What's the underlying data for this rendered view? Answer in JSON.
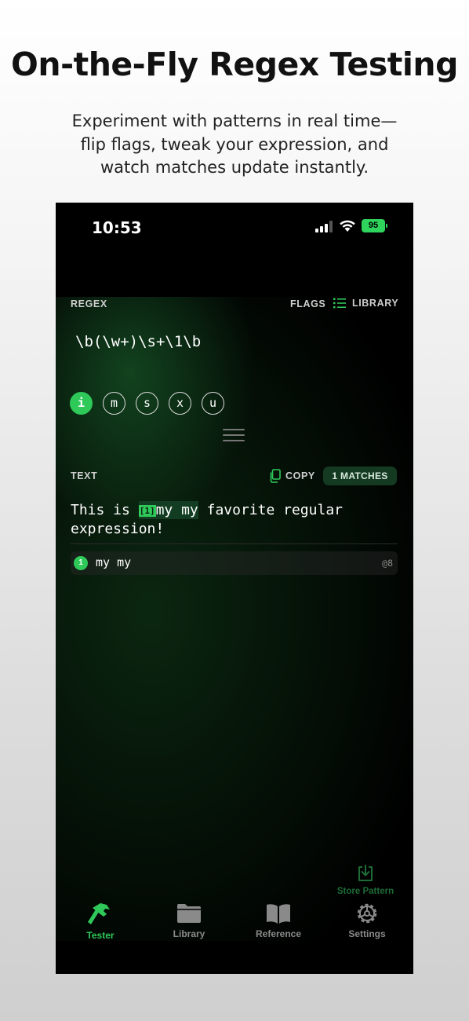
{
  "promo": {
    "headline": "On-the-Fly Regex Testing",
    "subhead": "Experiment with patterns in real time— flip flags, tweak your expression, and watch matches update instantly."
  },
  "status_bar": {
    "time": "10:53",
    "battery": "95"
  },
  "regex_section": {
    "label": "REGEX",
    "flags_button": "FLAGS",
    "library_button": "LIBRARY",
    "pattern": "\\b(\\w+)\\s+\\1\\b",
    "flags": [
      {
        "label": "i",
        "active": true
      },
      {
        "label": "m",
        "active": false
      },
      {
        "label": "s",
        "active": false
      },
      {
        "label": "x",
        "active": false
      },
      {
        "label": "u",
        "active": false
      }
    ]
  },
  "text_section": {
    "label": "TEXT",
    "copy_button": "COPY",
    "matches_badge": "1 MATCHES",
    "text_before": "This is ",
    "highlight_tag": "[1]",
    "highlight_text": "my my",
    "text_after": " favorite regular expression!"
  },
  "matches": [
    {
      "index": "1",
      "text": "my my",
      "position": "@8"
    }
  ],
  "store_pattern": "Store Pattern",
  "tabs": [
    {
      "label": "Tester",
      "icon": "hammer-icon",
      "active": true
    },
    {
      "label": "Library",
      "icon": "folder-icon",
      "active": false
    },
    {
      "label": "Reference",
      "icon": "book-icon",
      "active": false
    },
    {
      "label": "Settings",
      "icon": "gear-icon",
      "active": false
    }
  ],
  "colors": {
    "accent": "#2fc95a",
    "background": "#000000",
    "match_highlight": "#123d22"
  }
}
